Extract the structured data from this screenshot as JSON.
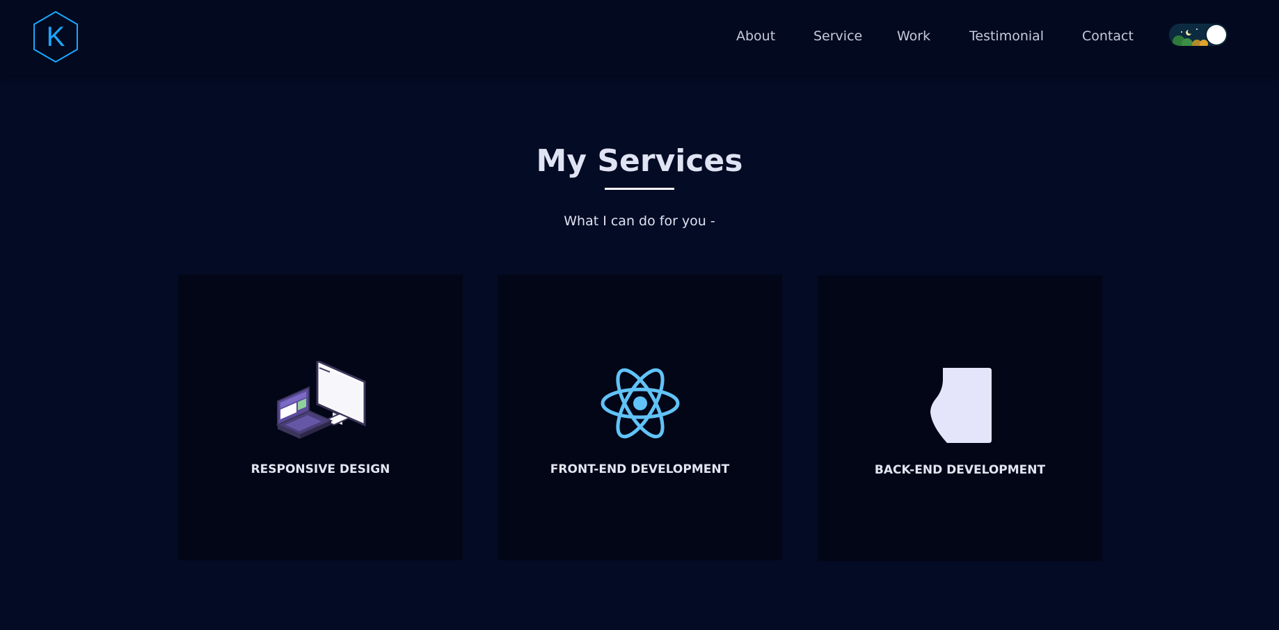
{
  "brand": {
    "logo_letter": "K",
    "accent_color": "#1aa7ff"
  },
  "nav": {
    "items": [
      {
        "label": "About"
      },
      {
        "label": "Service"
      },
      {
        "label": "Work"
      },
      {
        "label": "Testimonial"
      },
      {
        "label": "Contact"
      }
    ],
    "theme_toggle": {
      "state": "dark"
    }
  },
  "main": {
    "title": "My Services",
    "subtitle": "What I can do for you -",
    "services": [
      {
        "title": "RESPONSIVE DESIGN",
        "icon": "devices-icon"
      },
      {
        "title": "FRONT-END DEVELOPMENT",
        "icon": "react-icon"
      },
      {
        "title": "BACK-END DEVELOPMENT",
        "icon": "server-icon"
      }
    ]
  },
  "colors": {
    "background": "#040b24",
    "navbar": "#030a20",
    "card": "#020617",
    "text": "#dfe3f3",
    "react_blue": "#61c3f7"
  }
}
